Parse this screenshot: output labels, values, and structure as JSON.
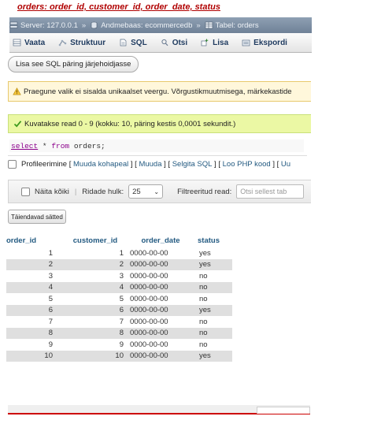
{
  "doc_title": "orders: order_id, customer_id, order_date, status",
  "breadcrumb": [
    {
      "label": "Server: 127.0.0.1",
      "icon": "server-icon"
    },
    {
      "label": "Andmebaas: ecommercedb",
      "icon": "database-icon"
    },
    {
      "label": "Tabel: orders",
      "icon": "table-icon"
    }
  ],
  "tabs": [
    {
      "label": "Vaata",
      "icon": "browse-icon"
    },
    {
      "label": "Struktuur",
      "icon": "structure-icon"
    },
    {
      "label": "SQL",
      "icon": "sql-icon"
    },
    {
      "label": "Otsi",
      "icon": "search-icon"
    },
    {
      "label": "Lisa",
      "icon": "insert-icon"
    },
    {
      "label": "Ekspordi",
      "icon": "export-icon"
    }
  ],
  "sql_sort_button": "Lisa see SQL päring järjehoidjasse",
  "notice_text": "Praegune valik ei sisalda unikaalset veergu. Võrgustikmuutmisega, märkekastide",
  "success_text": "Kuvatakse read 0 - 9 (kokku: 10, päring kestis 0,0001 sekundit.)",
  "sql_query": {
    "kw1": "select",
    "rest1": " * ",
    "kw2": "from",
    "rest2": " orders;"
  },
  "profiling": {
    "label": "Profileerimine",
    "links": [
      "Muuda kohapeal",
      "Muuda",
      "Selgita SQL",
      "Loo PHP kood",
      "Uu"
    ]
  },
  "nav": {
    "show_all": "Näita kõiki",
    "rows_label": "Ridade hulk:",
    "rows_value": "25",
    "filter_label": "Filtreeritud read:",
    "filter_placeholder": "Otsi sellest tab"
  },
  "extra_options_button": "Täiendavad sätted",
  "table": {
    "columns": [
      "order_id",
      "customer_id",
      "order_date",
      "status"
    ],
    "rows": [
      [
        "1",
        "1",
        "0000-00-00",
        "yes"
      ],
      [
        "2",
        "2",
        "0000-00-00",
        "yes"
      ],
      [
        "3",
        "3",
        "0000-00-00",
        "no"
      ],
      [
        "4",
        "4",
        "0000-00-00",
        "no"
      ],
      [
        "5",
        "5",
        "0000-00-00",
        "no"
      ],
      [
        "6",
        "6",
        "0000-00-00",
        "yes"
      ],
      [
        "7",
        "7",
        "0000-00-00",
        "no"
      ],
      [
        "8",
        "8",
        "0000-00-00",
        "no"
      ],
      [
        "9",
        "9",
        "0000-00-00",
        "no"
      ],
      [
        "10",
        "10",
        "0000-00-00",
        "yes"
      ]
    ]
  },
  "colors": {
    "accent": "#235a81",
    "title": "#b00000",
    "success_bg": "#ebf8a4",
    "notice_bg": "#fff7db"
  }
}
